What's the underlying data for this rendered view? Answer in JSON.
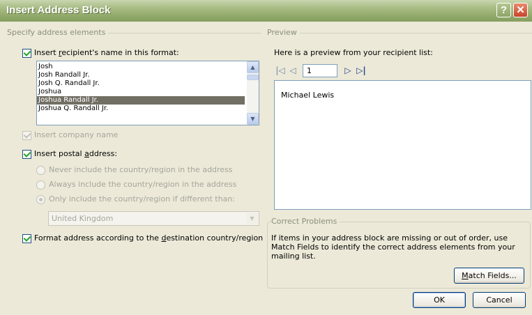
{
  "window": {
    "title": "Insert Address Block",
    "help_glyph": "?",
    "close_glyph": "✕"
  },
  "specify": {
    "group_label": "Specify address elements",
    "name_check": {
      "prefix": "Insert ",
      "accel": "r",
      "suffix": "ecipient's name in this format:",
      "checked": true
    },
    "name_formats": [
      "Josh",
      "Josh Randall Jr.",
      "Josh Q. Randall Jr.",
      "Joshua",
      "Joshua Randall Jr.",
      "Joshua Q. Randall Jr."
    ],
    "selected_format": "Joshua Randall Jr.",
    "company_check": {
      "label": "Insert company name",
      "checked": true,
      "disabled": true
    },
    "postal_check": {
      "prefix": "Insert postal ",
      "accel": "a",
      "suffix": "ddress:",
      "checked": true
    },
    "country_options": [
      "Never include the country/region in the address",
      "Always include the country/region in the address",
      "Only include the country/region if different than:"
    ],
    "selected_country_option": "Only include the country/region if different than:",
    "country_value": "United Kingdom",
    "format_check": {
      "prefix": "Format address according to the ",
      "accel": "d",
      "suffix": "estination country/region",
      "checked": true
    }
  },
  "preview": {
    "group_label": "Preview",
    "intro": "Here is a preview from your recipient list:",
    "record_number": "1",
    "preview_text": "Michael Lewis"
  },
  "problems": {
    "group_label": "Correct Problems",
    "text": "If items in your address block are missing or out of order, use Match Fields to identify the correct address elements from your mailing list.",
    "match_fields": {
      "accel": "M",
      "suffix": "atch Fields..."
    }
  },
  "buttons": {
    "ok": "OK",
    "cancel": "Cancel"
  },
  "icons": {
    "first": "first-record-icon",
    "prev": "previous-record-icon",
    "next": "next-record-icon",
    "last": "last-record-icon",
    "scroll_up": "scroll-up-icon",
    "scroll_down": "scroll-down-icon",
    "dropdown": "chevron-down-icon"
  },
  "colors": {
    "title_bar": "#9cb374",
    "dialog_bg": "#ece9d8",
    "selection": "#716f64",
    "disabled_text": "#a5a59a",
    "check_mark": "#21a121"
  }
}
